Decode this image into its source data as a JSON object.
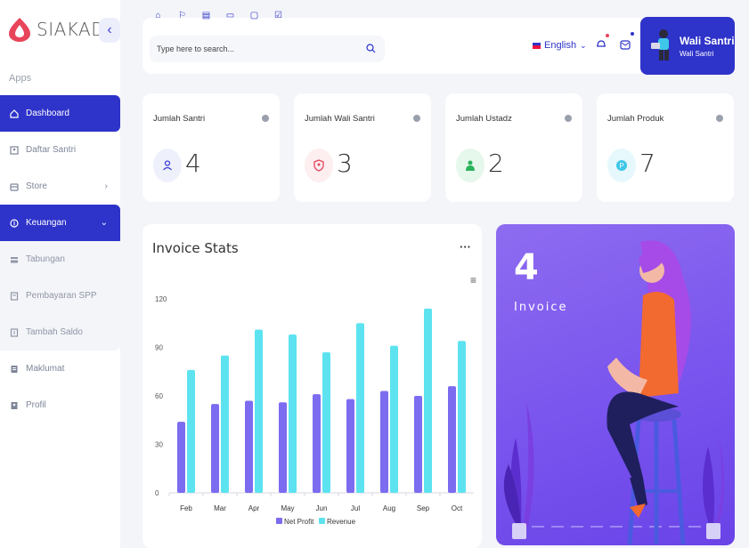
{
  "app": {
    "name": "SIAKAD"
  },
  "sidebar": {
    "section_label": "Apps",
    "items": [
      {
        "label": "Dashboard",
        "icon": "home-icon",
        "active": true
      },
      {
        "label": "Daftar Santri",
        "icon": "id-card-icon"
      },
      {
        "label": "Store",
        "icon": "store-icon",
        "arrow": "›"
      },
      {
        "label": "Keuangan",
        "icon": "money-icon",
        "active": true,
        "arrow": "⌄"
      }
    ],
    "sub_items": [
      {
        "label": "Tabungan",
        "icon": "wallet-icon"
      },
      {
        "label": "Pembayaran SPP",
        "icon": "receipt-icon"
      },
      {
        "label": "Tambah Saldo",
        "icon": "balance-icon"
      }
    ],
    "bottom_items": [
      {
        "label": "Maklumat",
        "icon": "document-icon"
      },
      {
        "label": "Profil",
        "icon": "profile-icon"
      }
    ]
  },
  "header": {
    "search_placeholder": "Type here to search...",
    "language": "English",
    "user_name": "Wali Santri",
    "user_role": "Wali Santri"
  },
  "stats": [
    {
      "title": "Jumlah Santri",
      "value": "4",
      "icon": "user-icon",
      "color": "#3b3bd8",
      "bg": "#eef0fb"
    },
    {
      "title": "Jumlah Wali Santri",
      "value": "3",
      "icon": "shield-user-icon",
      "color": "#e8445a",
      "bg": "#fdeef0"
    },
    {
      "title": "Jumlah Ustadz",
      "value": "2",
      "icon": "teacher-icon",
      "color": "#2bb35c",
      "bg": "#e6f7ec"
    },
    {
      "title": "Jumlah Produk",
      "value": "7",
      "icon": "product-icon",
      "color": "#3ec7e8",
      "bg": "#e6f8fc"
    }
  ],
  "invoice": {
    "count": "4",
    "label": "Invoice"
  },
  "colors": {
    "primary": "#2e33c9",
    "net_profit": "#7b6cf0",
    "revenue": "#5de3f0"
  },
  "chart_data": {
    "type": "bar",
    "title": "Invoice Stats",
    "categories": [
      "Feb",
      "Mar",
      "Apr",
      "May",
      "Jun",
      "Jul",
      "Aug",
      "Sep",
      "Oct"
    ],
    "series": [
      {
        "name": "Net Profit",
        "values": [
          44,
          55,
          57,
          56,
          61,
          58,
          63,
          60,
          66
        ]
      },
      {
        "name": "Revenue",
        "values": [
          76,
          85,
          101,
          98,
          87,
          105,
          91,
          114,
          94
        ]
      }
    ],
    "ylim": [
      0,
      120
    ],
    "yticks": [
      0,
      30,
      60,
      90,
      120
    ],
    "legend": "bottom",
    "grid": false
  }
}
